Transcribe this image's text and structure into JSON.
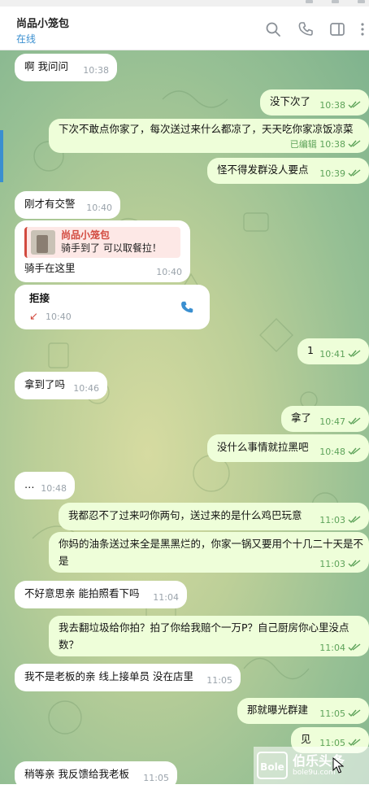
{
  "header": {
    "title": "尚品小笼包",
    "status": "在线"
  },
  "messages": [
    {
      "text": "啊  我问问",
      "time": "10:38"
    },
    {
      "text": "没下次了",
      "time": "10:38"
    },
    {
      "text": "下次不敢点你家了，每次送过来什么都凉了，天天吃你家凉饭凉菜",
      "edited": "已编辑",
      "time": "10:38"
    },
    {
      "text": "怪不得发群没人要点",
      "time": "10:39"
    },
    {
      "text": "刚才有交警",
      "time": "10:40"
    },
    {
      "quote_name": "尚品小笼包",
      "quote_text": "骑手到了    可以取餐拉！",
      "text": "骑手在这里",
      "time": "10:40"
    },
    {
      "call_label": "拒接",
      "arrow": "↙",
      "time": "10:40"
    },
    {
      "text": "1",
      "time": "10:41"
    },
    {
      "text": "拿到了吗",
      "time": "10:46"
    },
    {
      "text": "拿了",
      "time": "10:47"
    },
    {
      "text": "没什么事情就拉黑吧",
      "time": "10:48"
    },
    {
      "text": "…",
      "time": "10:48"
    },
    {
      "text": "我都忍不了过来叼你两句，送过来的是什么鸡巴玩意",
      "time": "11:03"
    },
    {
      "text": "你妈的油条送过来全是黑黑烂的，你家一锅又要用个十几二十天是不是",
      "time": "11:03"
    },
    {
      "text": "不好意思亲  能拍照看下吗",
      "time": "11:04"
    },
    {
      "text": "我去翻垃圾给你拍？拍了你给我赔个一万P？自己厨房你心里没点数？",
      "time": "11:04"
    },
    {
      "text": "我不是老板的亲  线上接单员 没在店里",
      "time": "11:05"
    },
    {
      "text": "那就曝光群建",
      "time": "11:05"
    },
    {
      "text": "见",
      "time": "11:05"
    },
    {
      "text": "稍等亲  我反馈给我老板",
      "time": "11:05"
    }
  ],
  "watermark": {
    "logo": "Bole",
    "name": "伯乐头条",
    "url": "bole9u.com"
  },
  "colors": {
    "accent": "#3a8fd0",
    "incoming": "#ffffff",
    "outgoing": "#eefed9",
    "check": "#5ea35a",
    "quote": "#d24a3f"
  },
  "icons": [
    "search-icon",
    "phone-icon",
    "sidebar-panel-icon",
    "more-icon",
    "missed-call-arrow-icon",
    "read-checks-icon"
  ]
}
